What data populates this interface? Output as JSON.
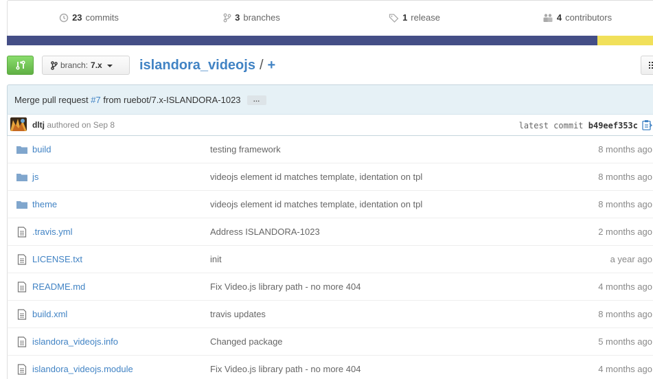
{
  "stats": {
    "commits_count": "23",
    "commits_label": "commits",
    "branches_count": "3",
    "branches_label": "branches",
    "releases_count": "1",
    "releases_label": "release",
    "contributors_count": "4",
    "contributors_label": "contributors"
  },
  "language_bar": {
    "colors": [
      "#444e86",
      "#f1e05a"
    ]
  },
  "toolbar": {
    "branch_prefix": "branch:",
    "branch_name": "7.x",
    "repo_name": "islandora_videojs",
    "separator": "/",
    "plus": "+"
  },
  "commit": {
    "message_prefix": "Merge pull request",
    "pr_link": "#7",
    "message_suffix": "from ruebot/7.x-ISLANDORA-1023",
    "ellipsis": "…",
    "author": "dltj",
    "authored_text": "authored on Sep 8",
    "latest_label": "latest commit",
    "sha": "b49eef353c"
  },
  "files": [
    {
      "type": "dir",
      "name": "build",
      "message": "testing framework",
      "age": "8 months ago"
    },
    {
      "type": "dir",
      "name": "js",
      "message": "videojs element id matches template, identation on tpl",
      "age": "8 months ago"
    },
    {
      "type": "dir",
      "name": "theme",
      "message": "videojs element id matches template, identation on tpl",
      "age": "8 months ago"
    },
    {
      "type": "file",
      "name": ".travis.yml",
      "message": "Address ISLANDORA-1023",
      "age": "2 months ago"
    },
    {
      "type": "file",
      "name": "LICENSE.txt",
      "message": "init",
      "age": "a year ago"
    },
    {
      "type": "file",
      "name": "README.md",
      "message": "Fix Video.js library path - no more 404",
      "age": "4 months ago"
    },
    {
      "type": "file",
      "name": "build.xml",
      "message": "travis updates",
      "age": "8 months ago"
    },
    {
      "type": "file",
      "name": "islandora_videojs.info",
      "message": "Changed package",
      "age": "5 months ago"
    },
    {
      "type": "file",
      "name": "islandora_videojs.module",
      "message": "Fix Video.js library path - no more 404",
      "age": "4 months ago"
    }
  ]
}
